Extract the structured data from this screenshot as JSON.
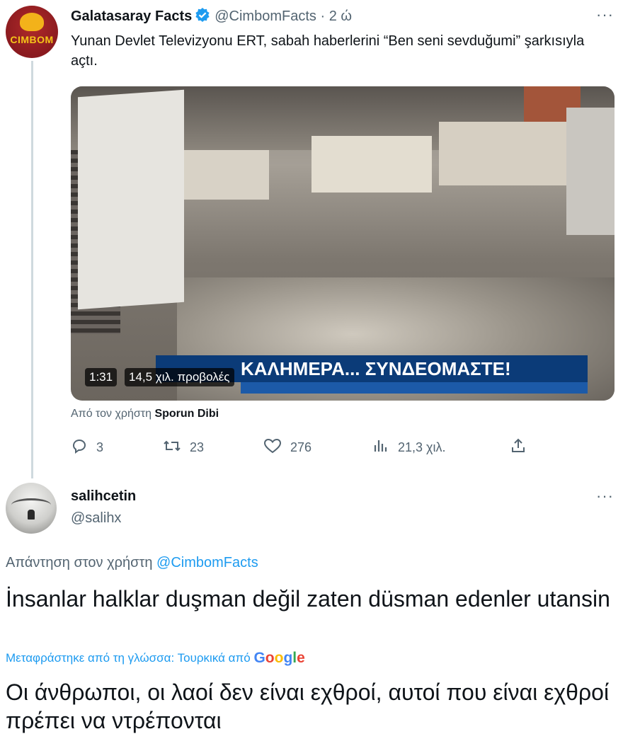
{
  "tweet": {
    "author_name": "Galatasaray Facts",
    "handle": "@CimbomFacts",
    "separator": "·",
    "time": "2 ώ",
    "avatar_text": "CIMBOM",
    "more": "···",
    "text": "Yunan Devlet Televizyonu ERT, sabah haberlerini “Ben seni sevduğumi” şarkısıyla açtı.",
    "video": {
      "duration": "1:31",
      "views": "14,5 χιλ. προβολές",
      "banner_text": "ΚΑΛΗΜΕΡΑ... ΣΥΝΔΕΟΜΑΣΤΕ!"
    },
    "source_prefix": "Από τον χρήστη",
    "source_user": "Sporun Dibi",
    "actions": {
      "replies": "3",
      "retweets": "23",
      "likes": "276",
      "views": "21,3 χιλ."
    }
  },
  "reply": {
    "name": "salihcetin",
    "handle": "@salihx",
    "more": "···",
    "reply_prefix": "Απάντηση στον χρήστη",
    "reply_handle": "@CimbomFacts",
    "text": "İnsanlar halklar duşman değil zaten düsman edenler utansin",
    "translated_from": "Μεταφράστηκε από τη γλώσσα: Τουρκικά από",
    "google": [
      "G",
      "o",
      "o",
      "g",
      "l",
      "e"
    ],
    "translation": "Οι άνθρωποι, οι λαοί δεν είναι εχθροί, αυτοί που είναι εχθροί πρέπει να ντρέπονται"
  },
  "colors": {
    "accent": "#1d9bf0",
    "secondary_text": "#536471",
    "verified": "#1d9bf0"
  },
  "icons": [
    "verified-badge-icon",
    "reply-icon",
    "retweet-icon",
    "like-icon",
    "views-icon",
    "share-icon",
    "more-icon"
  ]
}
